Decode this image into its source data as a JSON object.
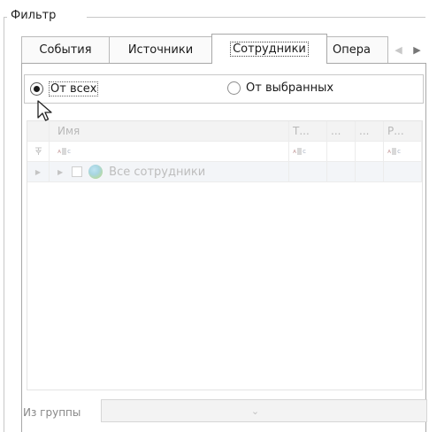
{
  "group": {
    "title": "Фильтр"
  },
  "tabs": [
    {
      "label": "События"
    },
    {
      "label": "Источники"
    },
    {
      "label": "Сотрудники"
    },
    {
      "label": "Опера"
    }
  ],
  "tab_scroll": {
    "left_icon": "arrow-left-icon",
    "right_icon": "arrow-right-icon"
  },
  "source_mode": {
    "option_all": {
      "label": "От всех",
      "checked": true
    },
    "option_selected": {
      "label": "От выбранных",
      "checked": false
    }
  },
  "grid": {
    "columns": [
      "Имя",
      "Т...",
      "...",
      "...",
      "Р..."
    ],
    "filter_row_icon": "abc-filter-icon",
    "rows": [
      {
        "name": "Все сотрудники",
        "checked": false,
        "icon": "globe-icon"
      }
    ]
  },
  "from_group": {
    "label": "Из группы",
    "value": ""
  },
  "colors": {
    "border": "#c8c8c8",
    "disabled_text": "#bdbdbd",
    "selected_row": "#f3f5f8"
  }
}
